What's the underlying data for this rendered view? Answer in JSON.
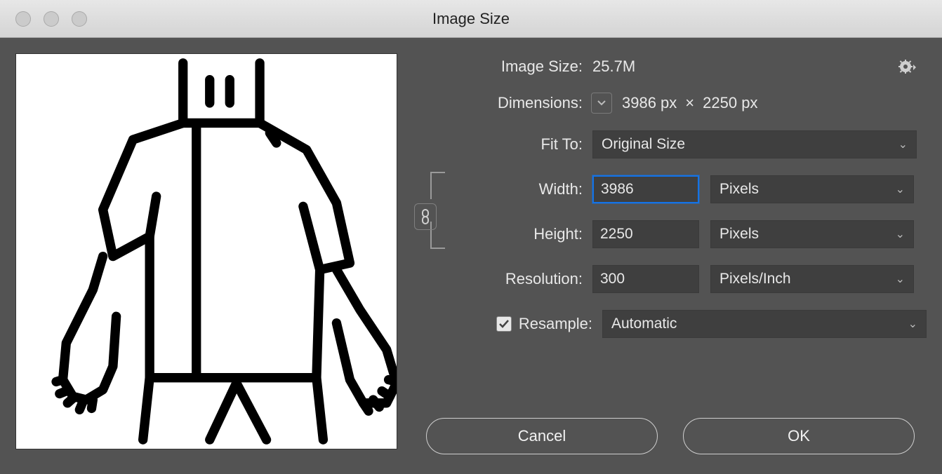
{
  "title": "Image Size",
  "imageSize": {
    "label": "Image Size:",
    "value": "25.7M"
  },
  "dimensions": {
    "label": "Dimensions:",
    "w": "3986 px",
    "sep": "×",
    "h": "2250 px"
  },
  "fitTo": {
    "label": "Fit To:",
    "value": "Original Size"
  },
  "width": {
    "label": "Width:",
    "value": "3986",
    "unit": "Pixels"
  },
  "height": {
    "label": "Height:",
    "value": "2250",
    "unit": "Pixels"
  },
  "resolution": {
    "label": "Resolution:",
    "value": "300",
    "unit": "Pixels/Inch"
  },
  "resample": {
    "label": "Resample:",
    "checked": true,
    "value": "Automatic"
  },
  "buttons": {
    "cancel": "Cancel",
    "ok": "OK"
  }
}
